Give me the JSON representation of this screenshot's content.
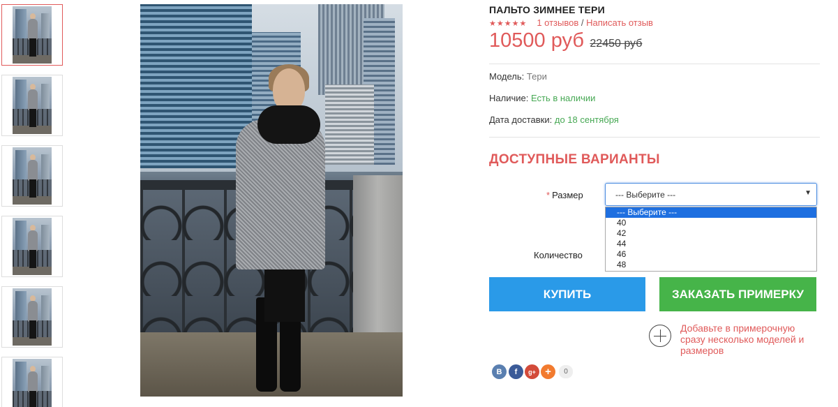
{
  "gallery": {
    "thumbnails": [
      {
        "active": true
      },
      {
        "active": false
      },
      {
        "active": false
      },
      {
        "active": false
      },
      {
        "active": false
      },
      {
        "active": false
      }
    ]
  },
  "product": {
    "title": "ПАЛЬТО ЗИМНЕЕ ТЕРИ",
    "stars": "★★★★★",
    "reviews_link": "1 отзывов",
    "separator": "/",
    "write_review_link": "Написать отзыв",
    "price": "10500 руб",
    "old_price": "22450 руб",
    "specs": {
      "model_label": "Модель:",
      "model_value": "Тери",
      "availability_label": "Наличие:",
      "availability_value": "Есть в наличии",
      "delivery_label": "Дата доставки:",
      "delivery_value": "до 18 сентября"
    }
  },
  "options": {
    "heading": "ДОСТУПНЫЕ ВАРИАНТЫ",
    "size_required_mark": "*",
    "size_label": "Размер",
    "size_selected": "--- Выберите ---",
    "size_options": [
      "--- Выберите ---",
      "40",
      "42",
      "44",
      "46",
      "48"
    ],
    "quantity_label": "Количество"
  },
  "actions": {
    "buy_label": "КУПИТЬ",
    "fitting_label": "ЗАКАЗАТЬ ПРИМЕРКУ",
    "add_note": "Добавьте в примерочную сразу несколько моделей и размеров"
  },
  "share": {
    "vk": "B",
    "fb": "f",
    "gplus": "g+",
    "more": "+",
    "count": "0"
  },
  "colors": {
    "accent_red": "#e05a5a",
    "buy_blue": "#2a9ae8",
    "fitting_green": "#46b449",
    "in_stock_green": "#46a853"
  }
}
